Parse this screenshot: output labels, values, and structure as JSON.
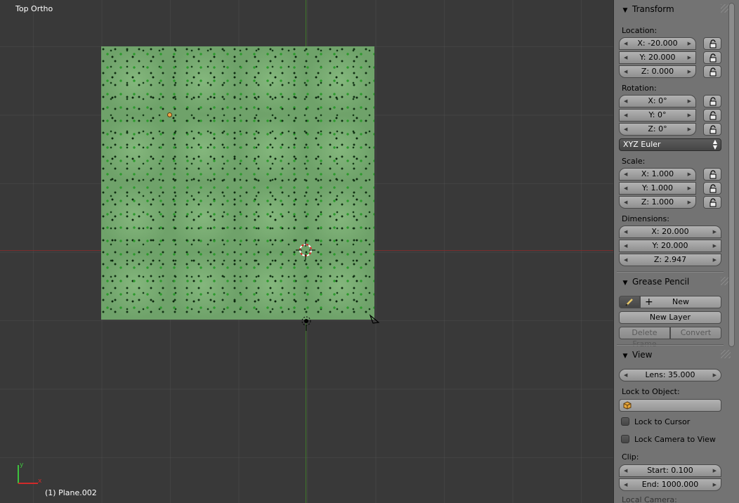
{
  "viewport": {
    "view_name": "Top Ortho",
    "object_name": "(1) Plane.002",
    "gizmo_x_label": "x",
    "gizmo_y_label": "y"
  },
  "transform": {
    "title": "Transform",
    "location_label": "Location:",
    "location": [
      "X: -20.000",
      "Y: 20.000",
      "Z: 0.000"
    ],
    "rotation_label": "Rotation:",
    "rotation": [
      "X: 0°",
      "Y: 0°",
      "Z: 0°"
    ],
    "rotation_mode": "XYZ Euler",
    "scale_label": "Scale:",
    "scale": [
      "X: 1.000",
      "Y: 1.000",
      "Z: 1.000"
    ],
    "dimensions_label": "Dimensions:",
    "dimensions": [
      "X: 20.000",
      "Y: 20.000",
      "Z: 2.947"
    ]
  },
  "grease_pencil": {
    "title": "Grease Pencil",
    "new_label": "New",
    "new_layer_label": "New Layer",
    "delete_frame_label": "Delete Frame",
    "convert_label": "Convert"
  },
  "view": {
    "title": "View",
    "lens": "Lens: 35.000",
    "lock_to_object_label": "Lock to Object:",
    "lock_to_cursor_label": "Lock to Cursor",
    "lock_camera_label": "Lock Camera to View",
    "clip_label": "Clip:",
    "clip_start": "Start: 0.100",
    "clip_end": "End: 1000.000",
    "local_camera_label": "Local Camera:"
  },
  "colors": {
    "viewport_bg": "#393939",
    "panel_bg": "#737373",
    "x_axis": "#7a2e2e",
    "y_axis": "#3f7a2b",
    "plane_base": "#6fa26a"
  }
}
